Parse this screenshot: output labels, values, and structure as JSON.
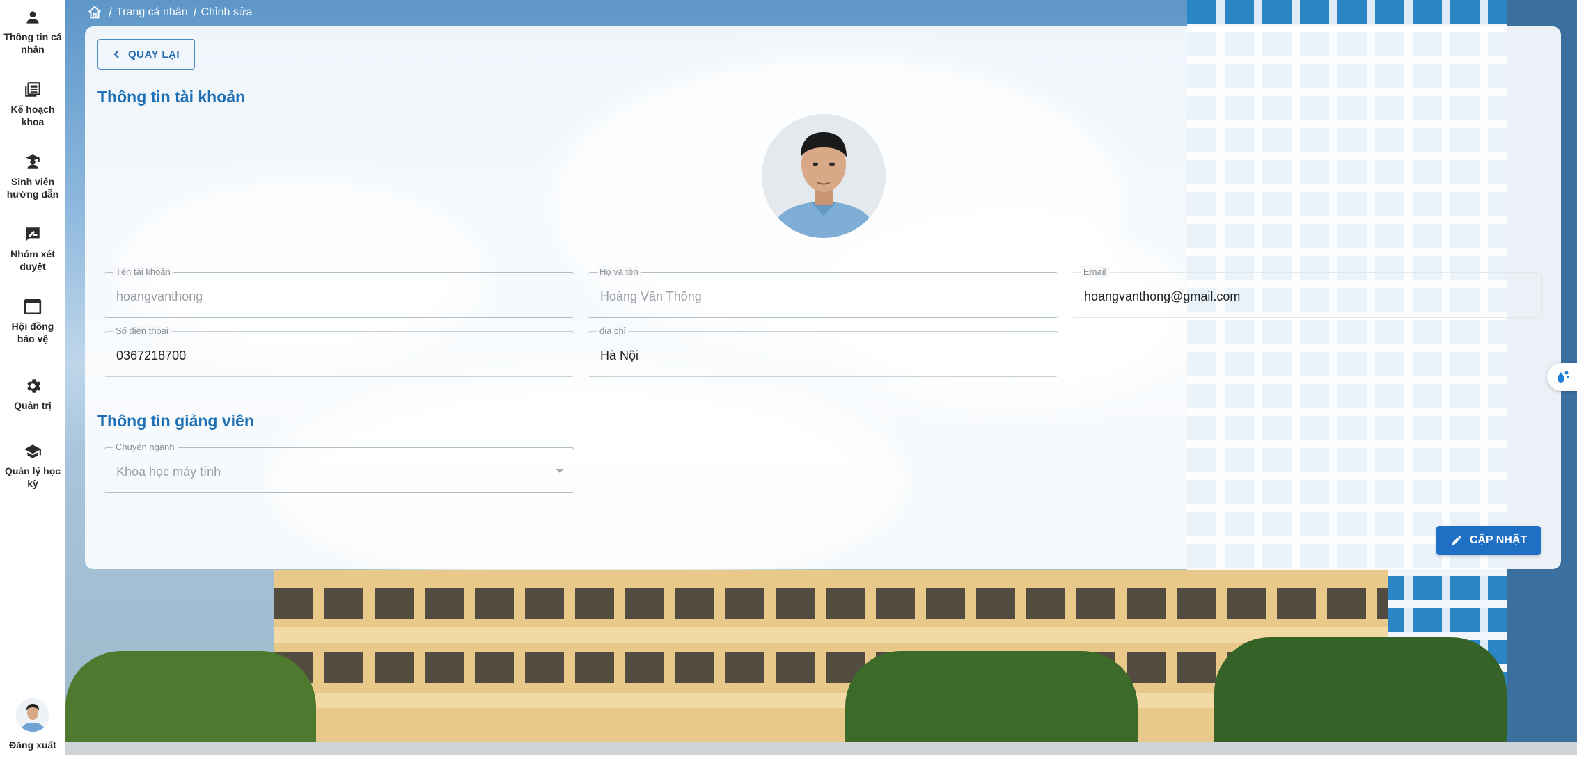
{
  "sidebar": {
    "items": [
      {
        "label": "Thông tin cá nhân",
        "icon": "person-icon"
      },
      {
        "label": "Kế hoạch khoa",
        "icon": "newspaper-icon"
      },
      {
        "label": "Sinh viên hướng dẫn",
        "icon": "student-icon"
      },
      {
        "label": "Nhóm xét duyệt",
        "icon": "rate-review-icon"
      },
      {
        "label": "Hội đồng bảo vệ",
        "icon": "window-icon"
      },
      {
        "label": "Quản trị",
        "icon": "gear-icon"
      },
      {
        "label": "Quản lý học kỳ",
        "icon": "graduation-cap-icon"
      }
    ],
    "logout_label": "Đăng xuất"
  },
  "breadcrumb": {
    "items": [
      "Trang cá nhân",
      "Chỉnh sửa"
    ]
  },
  "back_button": {
    "label": "QUAY LẠI"
  },
  "account_section": {
    "title": "Thông tin tài khoản",
    "fields": {
      "username": {
        "label": "Tên tài khoản",
        "value": "hoangvanthong"
      },
      "fullname": {
        "label": "Họ và tên",
        "value": "Hoàng Văn Thông"
      },
      "email": {
        "label": "Email",
        "value": "hoangvanthong@gmail.com"
      },
      "phone": {
        "label": "Số điện thoại",
        "value": "0367218700"
      },
      "address": {
        "label": "địa chỉ",
        "value": "Hà Nội"
      }
    }
  },
  "lecturer_section": {
    "title": "Thông tin giảng viên",
    "major": {
      "label": "Chuyên ngành",
      "value": "Khoa học máy tính"
    }
  },
  "update_button": {
    "label": "CẬP NHẬT"
  },
  "colors": {
    "accent": "#1f6fc4",
    "title": "#1f6fb4",
    "sidebar_text": "#2b2b2b"
  }
}
